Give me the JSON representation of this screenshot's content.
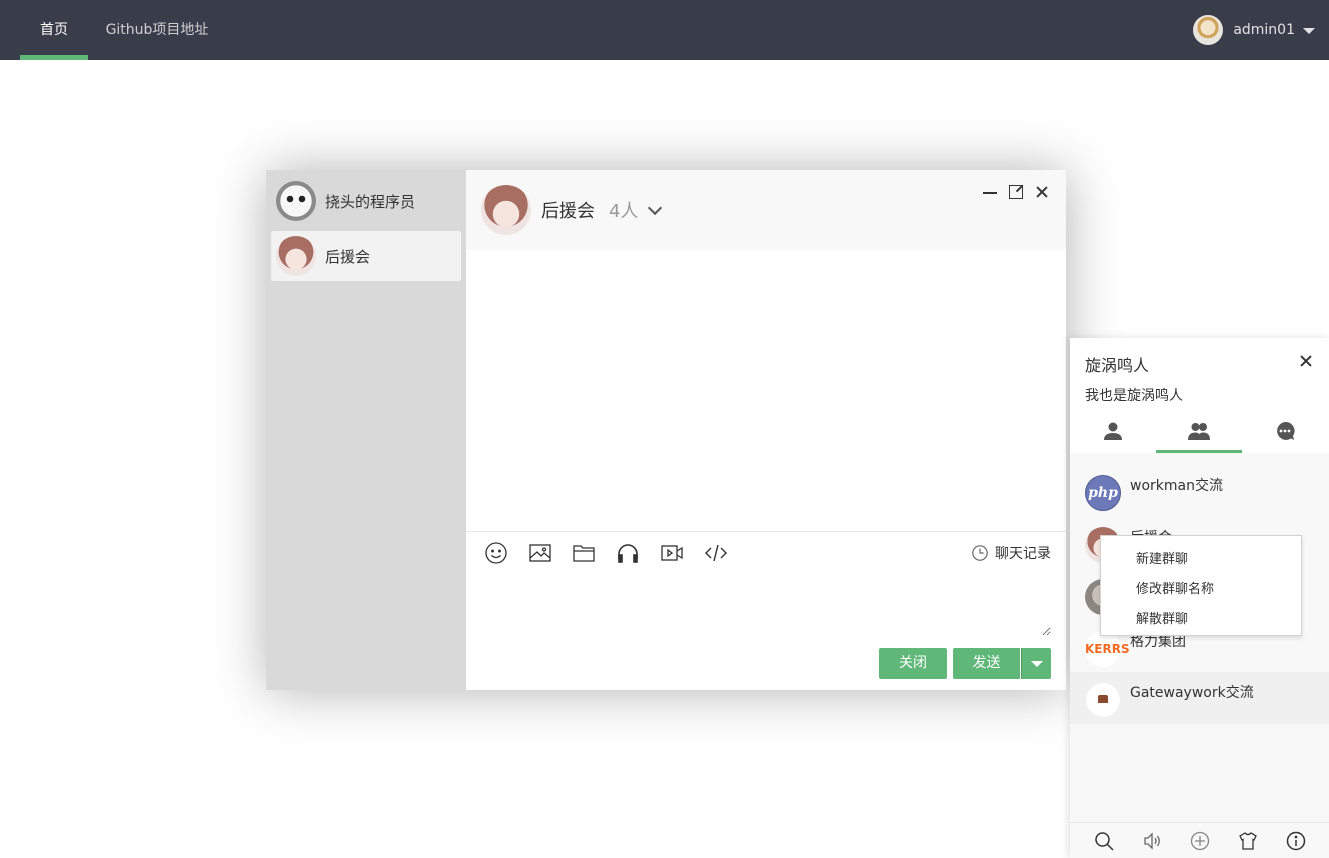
{
  "nav": {
    "home": "首页",
    "github": "Github项目地址",
    "username": "admin01"
  },
  "chat_list": [
    {
      "name": "挠头的程序员",
      "avatar": "panda-avatar"
    },
    {
      "name": "后援会",
      "avatar": "girl-avatar"
    }
  ],
  "chat": {
    "title": "后援会",
    "member_count": "4人",
    "history_label": "聊天记录",
    "input_value": "",
    "close_label": "关闭",
    "send_label": "发送"
  },
  "toolbar_icons": [
    "emoji-icon",
    "image-icon",
    "folder-icon",
    "audio-icon",
    "video-icon",
    "code-icon"
  ],
  "panel": {
    "name": "旋涡鸣人",
    "sign": "我也是旋涡鸣人",
    "tabs": [
      "friend-icon",
      "group-icon",
      "message-icon"
    ],
    "groups": [
      {
        "name": "workman交流",
        "avatar_text": "php"
      },
      {
        "name": "后援会"
      },
      {
        "name": ""
      },
      {
        "name": "格力集团",
        "avatar_text": "KERRS"
      },
      {
        "name": "Gatewaywork交流"
      }
    ],
    "bottom_icons": [
      "search-icon",
      "sound-icon",
      "add-icon",
      "skin-icon",
      "about-icon"
    ]
  },
  "context_menu": {
    "items": [
      "新建群聊",
      "修改群聊名称",
      "解散群聊"
    ]
  },
  "colors": {
    "nav_bg": "#393d49",
    "accent": "#5fb878",
    "sidebar_bg": "#d9d9d9"
  }
}
